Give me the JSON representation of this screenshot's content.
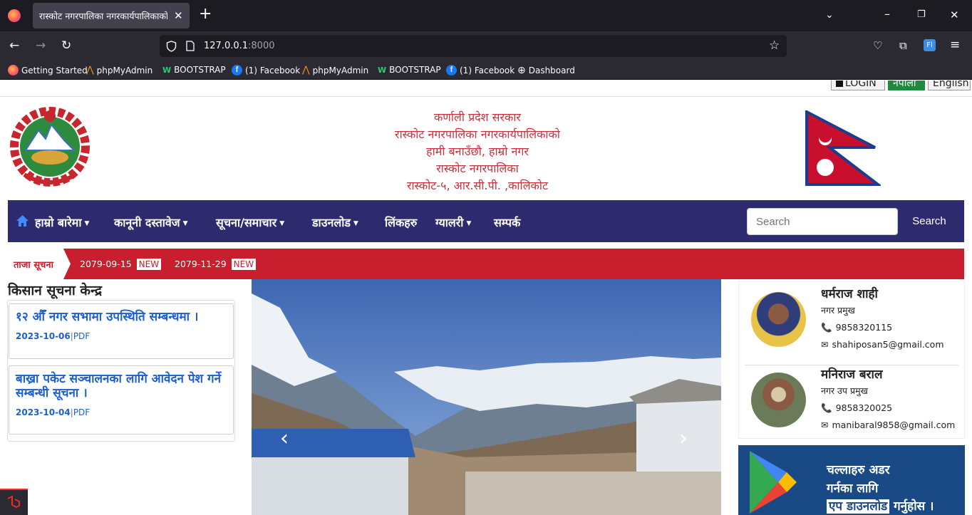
{
  "browser": {
    "tab_title": "रास्कोट नगरपालिका नगरकार्यपालिकाको",
    "url_host": "127.0.0.1",
    "url_port": ":8000",
    "bookmarks": [
      {
        "label": "Getting Started",
        "icon": "firefox-icon"
      },
      {
        "label": "phpMyAdmin",
        "icon": "phpmyadmin-icon"
      },
      {
        "label": "BOOTSTRAP",
        "icon": "w-icon"
      },
      {
        "label": "(1) Facebook",
        "icon": "facebook-icon"
      },
      {
        "label": "phpMyAdmin",
        "icon": "phpmyadmin-icon"
      },
      {
        "label": "BOOTSTRAP",
        "icon": "w-icon"
      },
      {
        "label": "(1) Facebook",
        "icon": "facebook-icon"
      },
      {
        "label": "Dashboard",
        "icon": "globe-icon"
      }
    ]
  },
  "topbar": {
    "login": "LOGIN",
    "nepali": "नेपाली",
    "english": "English"
  },
  "header": {
    "line1": "कर्णाली प्रदेश सरकार",
    "line2": "रास्कोट नगरपालिका नगरकार्यपालिकाको",
    "line3": "हामी बनाउँछौ, हाम्रो नगर",
    "line4": "रास्कोट नगरपालिका",
    "line5": "रास्कोट-५, आर.सी.पी. ,कालिकोट"
  },
  "menu": {
    "items": [
      "हाम्रो बारेमा",
      "कानूनी दस्तावेज",
      "सूचना/समाचार",
      "डाउनलोड",
      "लिंकहरु",
      "ग्यालरी",
      "सम्पर्क"
    ],
    "search_placeholder": "Search",
    "search_button": "Search"
  },
  "ticker": {
    "label": "ताजा सूचना",
    "items": [
      {
        "date": "2079-09-15",
        "badge": "NEW"
      },
      {
        "date": "2079-11-29",
        "badge": "NEW"
      }
    ]
  },
  "left": {
    "heading": "किसान सूचना केन्द्र",
    "notices": [
      {
        "title": "१२ औँ नगर सभामा उपस्थिति सम्बन्धमा ।",
        "date": "2023-10-06",
        "sep": "|",
        "type": "PDF"
      },
      {
        "title": "बाख्रा पकेट सञ्चालनका लागि आवेदन पेश गर्ने सम्बन्धी सूचना ।",
        "date": "2023-10-04",
        "sep": "|",
        "type": "PDF"
      }
    ]
  },
  "officials": [
    {
      "name": "धर्मराज शाही",
      "role": "नगर प्रमुख",
      "phone": "9858320115",
      "email": "shahiposan5@gmail.com"
    },
    {
      "name": "मनिराज बराल",
      "role": "नगर उप प्रमुख",
      "phone": "9858320025",
      "email": "manibaral9858@gmail.com"
    }
  ],
  "app_banner": {
    "line1": "चल्लाहरु अडर",
    "line2": "गर्नका लागि",
    "line3a": "एप डाउनलोड",
    "line3b": "गर्नुहोस ।"
  },
  "colors": {
    "menu_bg": "#2e2a6e",
    "ticker_bg": "#c81e2d",
    "header_text": "#c9313a",
    "link": "#1a5fd6"
  }
}
